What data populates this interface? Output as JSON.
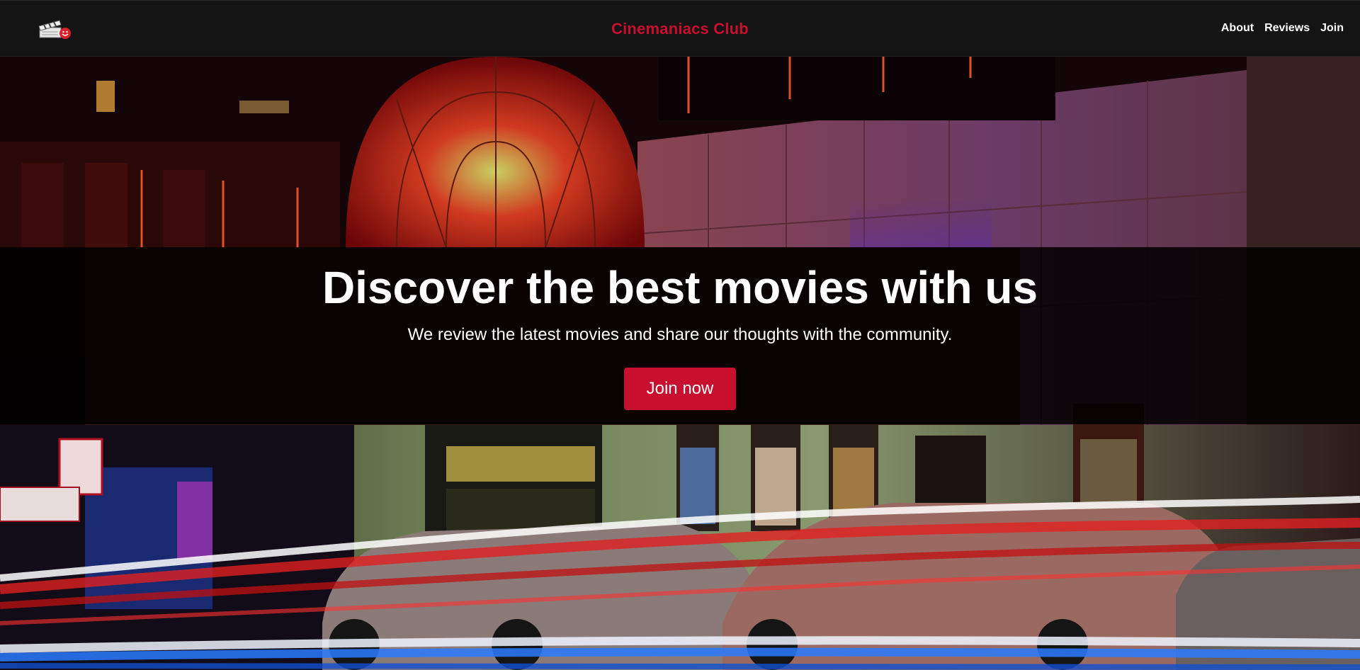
{
  "navbar": {
    "logo_icon": "film-clapperboard-smiley-icon",
    "brand": "Cinemaniacs Club",
    "links": [
      "About",
      "Reviews",
      "Join"
    ]
  },
  "hero": {
    "background": "night street photo of a cinema facade with red and blue light trails",
    "title": "Discover the best movies with us",
    "subtitle": "We review the latest movies and share our thoughts with the community.",
    "cta_label": "Join now"
  },
  "colors": {
    "accent": "#c8102e",
    "navbar_bg": "#141414",
    "text": "#ffffff"
  }
}
